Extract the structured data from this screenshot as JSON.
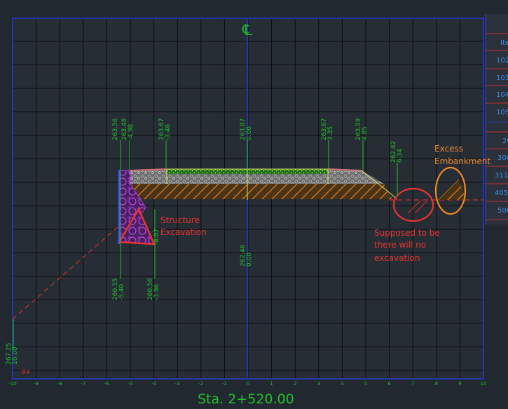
{
  "drawing": {
    "centerline_symbol": "℄",
    "station_label": "Sta. 2+520.00",
    "corner_mark": "84",
    "x_ticks": [
      "-10",
      "-9",
      "-8",
      "-7",
      "-6",
      "-5",
      "-4",
      "-3",
      "-2",
      "-1",
      "0",
      "1",
      "2",
      "3",
      "4",
      "5",
      "6",
      "7",
      "8",
      "9",
      "10"
    ],
    "elevation_labels": [
      {
        "elev": "263.56",
        "offset": ""
      },
      {
        "elev": "263.48",
        "offset": "-4.98"
      },
      {
        "elev": "263.67",
        "offset": "-3.46"
      },
      {
        "elev": "263.87",
        "offset": "0.00"
      },
      {
        "elev": "263.67",
        "offset": "3.35"
      },
      {
        "elev": "263.59",
        "offset": "4.85"
      },
      {
        "elev": "262.42",
        "offset": "6.34"
      },
      {
        "elev": "262.46",
        "offset": "0.00"
      },
      {
        "elev": "260.55",
        "offset": "-5.40"
      },
      {
        "elev": "260.56",
        "offset": "-3.96"
      },
      {
        "elev": "",
        "offset": "-4.07"
      },
      {
        "elev": "267.25",
        "offset": "10.00"
      }
    ],
    "right_table_cells": [
      "Ite",
      "102",
      "103",
      "104",
      "105",
      "",
      "20",
      "300",
      "311",
      "405",
      "500"
    ],
    "colors": {
      "background": "#212830",
      "grid": "#0c0c0c",
      "frame": "#2436a8",
      "green_text": "#22c02a",
      "red_annot": "#e8322f",
      "orange_annot": "#f08a2a"
    }
  },
  "annotations": {
    "structure_excavation": [
      "Structure",
      "Excavation"
    ],
    "supposed": [
      "Supposed to be",
      "there will no",
      "excavation"
    ],
    "excess": [
      "Excess",
      "Embankment"
    ]
  }
}
